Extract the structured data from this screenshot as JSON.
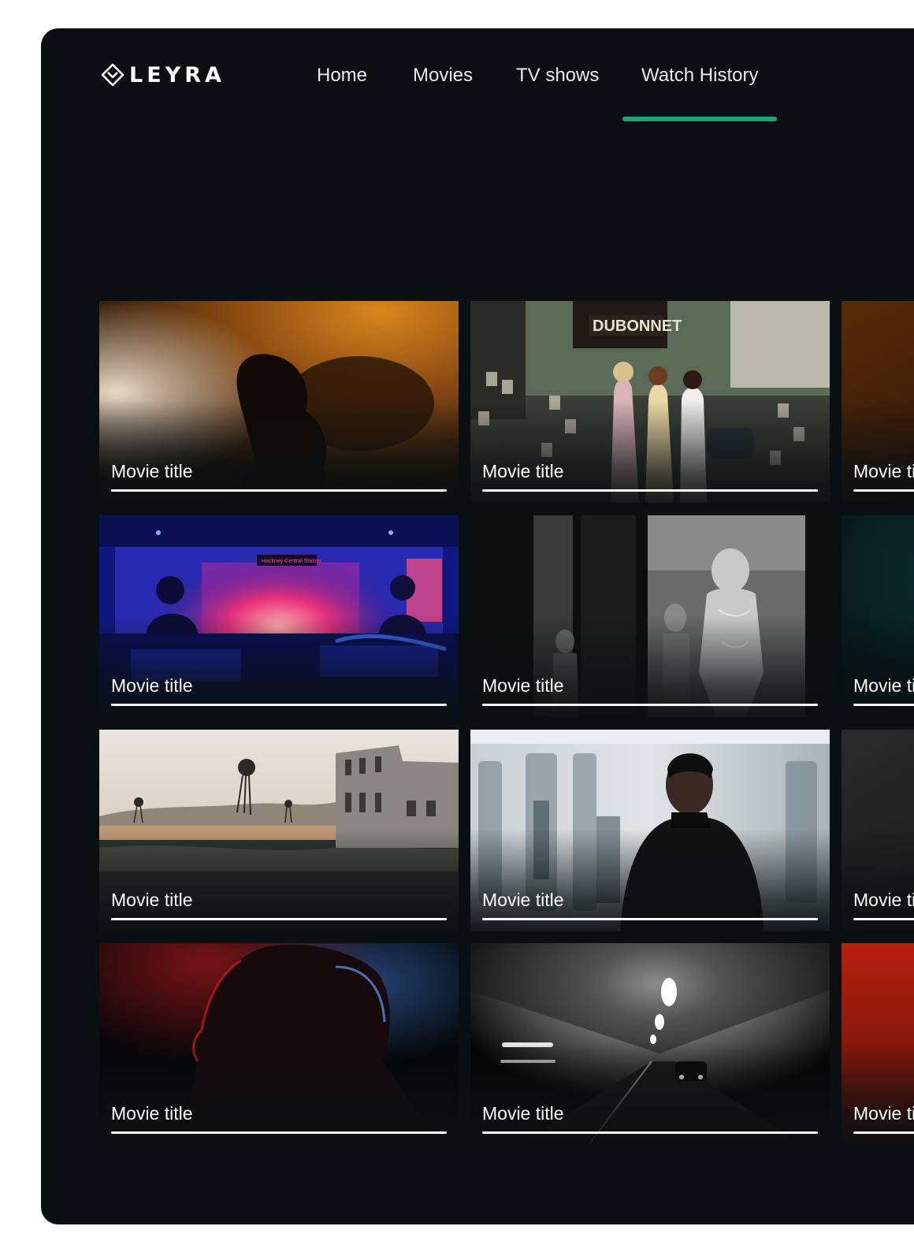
{
  "app": {
    "logo_text": "LEYRA",
    "accent_color": "#1aa776"
  },
  "nav": {
    "items": [
      {
        "label": "Home",
        "active": false
      },
      {
        "label": "Movies",
        "active": false
      },
      {
        "label": "TV shows",
        "active": false
      },
      {
        "label": "Watch History",
        "active": true
      }
    ]
  },
  "history": {
    "items": [
      {
        "title": "Movie title",
        "progress": 1.0,
        "scene": "silhouette-warm"
      },
      {
        "title": "Movie title",
        "progress": 1.0,
        "scene": "street-kiosk"
      },
      {
        "title": "Movie title",
        "progress": 1.0,
        "scene": "amber-dark"
      },
      {
        "title": "Movie title",
        "progress": 1.0,
        "scene": "neon-bus"
      },
      {
        "title": "Movie title",
        "progress": 1.0,
        "scene": "chrome-robot"
      },
      {
        "title": "Movie title",
        "progress": 1.0,
        "scene": "teal-dark"
      },
      {
        "title": "Movie title",
        "progress": 1.0,
        "scene": "desert-ruins"
      },
      {
        "title": "Movie title",
        "progress": 1.0,
        "scene": "subway-man"
      },
      {
        "title": "Movie title",
        "progress": 1.0,
        "scene": "grey-dark"
      },
      {
        "title": "Movie title",
        "progress": 1.0,
        "scene": "red-profile"
      },
      {
        "title": "Movie title",
        "progress": 1.0,
        "scene": "tunnel-lights"
      },
      {
        "title": "Movie title",
        "progress": 1.0,
        "scene": "red-solid"
      }
    ]
  }
}
